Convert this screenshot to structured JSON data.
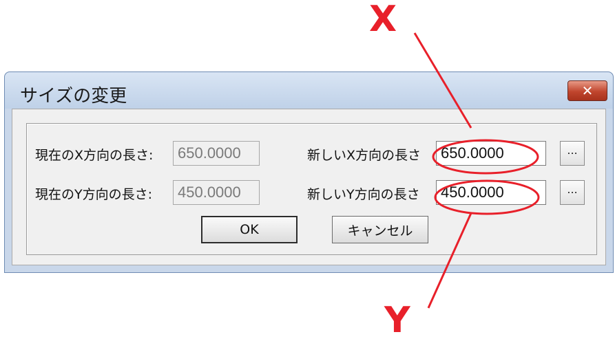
{
  "dialog": {
    "title": "サイズの変更",
    "close_label": "✕"
  },
  "form": {
    "current_x_label": "現在のX方向の長さ:",
    "current_x_value": "650.0000",
    "current_y_label": "現在のY方向の長さ:",
    "current_y_value": "450.0000",
    "new_x_label": "新しいX方向の長さ",
    "new_x_value": "650.0000",
    "new_y_label": "新しいY方向の長さ",
    "new_y_value": "450.0000",
    "browse_label": "..."
  },
  "buttons": {
    "ok_label": "OK",
    "cancel_label": "キャンセル"
  },
  "annotations": {
    "x_label": "X",
    "y_label": "Y",
    "color": "#e8202a"
  }
}
